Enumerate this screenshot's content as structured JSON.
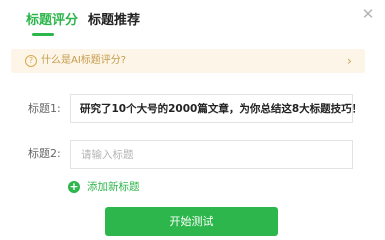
{
  "tabs": {
    "items": [
      {
        "label": "标题评分",
        "active": true
      },
      {
        "label": "标题推荐",
        "active": false
      }
    ]
  },
  "close_icon": "close-icon",
  "notice": {
    "icon": "question-circle-icon",
    "text": "什么是AI标题评分?",
    "chevron": "chevron-right-icon"
  },
  "titles": [
    {
      "label": "标题1:",
      "value": "研究了10个大号的2000篇文章，为你总结这8大标题技巧！"
    },
    {
      "label": "标题2:",
      "value": "",
      "placeholder": "请输入标题"
    }
  ],
  "add_title": {
    "icon": "plus-circle-icon",
    "label": "添加新标题"
  },
  "start_button": {
    "label": "开始测试"
  },
  "colors": {
    "accent": "#2db64b",
    "notice_bg": "#fdf6e8",
    "notice_text": "#c59a4b"
  }
}
